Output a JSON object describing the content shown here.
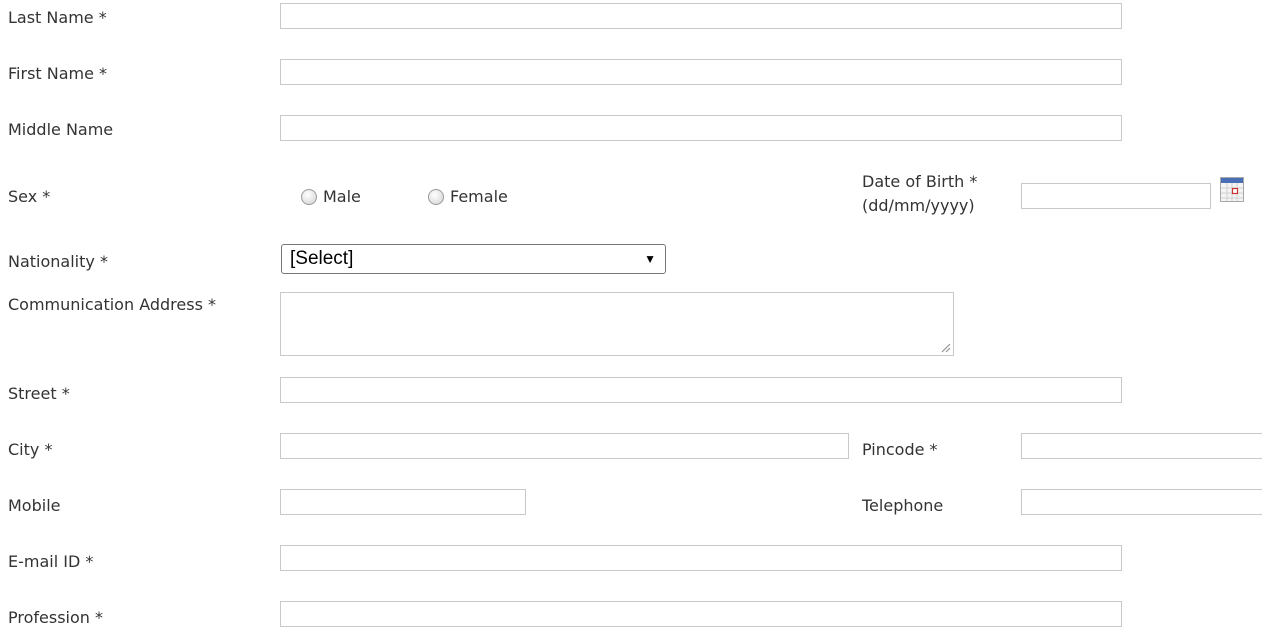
{
  "form": {
    "last_name_label": "Last Name *",
    "first_name_label": "First Name *",
    "middle_name_label": "Middle Name",
    "sex_label": "Sex *",
    "sex_options": {
      "male": "Male",
      "female": "Female"
    },
    "dob_label_line1": "Date of Birth *",
    "dob_label_line2": "(dd/mm/yyyy)",
    "nationality_label": "Nationality *",
    "nationality_selected": "[Select]",
    "address_label": "Communication Address *",
    "street_label": "Street *",
    "city_label": "City *",
    "pincode_label": "Pincode *",
    "mobile_label": "Mobile",
    "telephone_label": "Telephone",
    "email_label": "E-mail ID *",
    "profession_label": "Profession *"
  },
  "icons": {
    "calendar": "calendar-icon",
    "dropdown": "triangle-down"
  }
}
